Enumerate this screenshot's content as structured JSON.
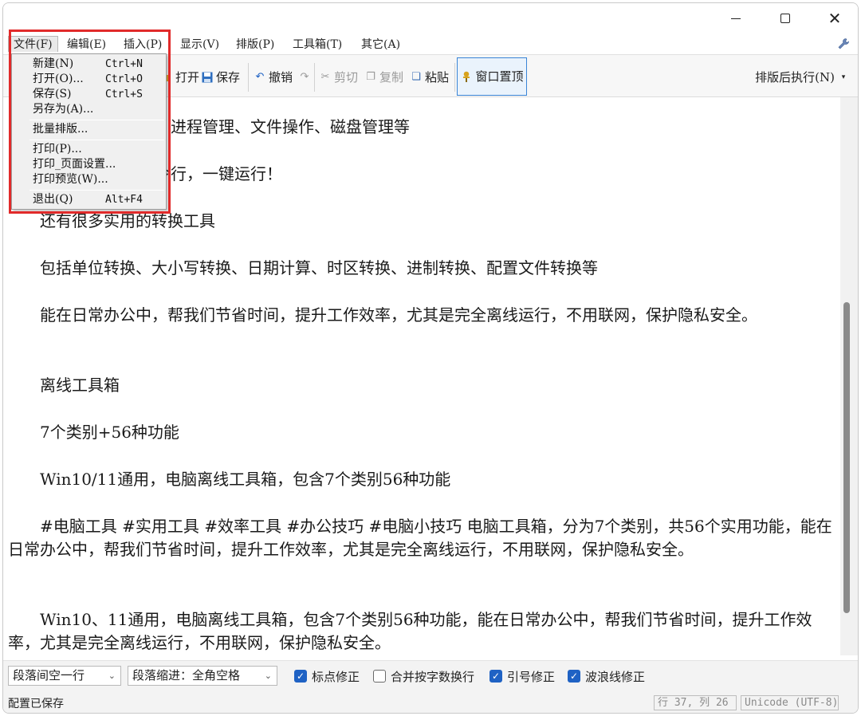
{
  "window_controls": {
    "minimize": "minimize",
    "maximize": "maximize",
    "close": "close"
  },
  "menu": [
    {
      "label": "文件(F)"
    },
    {
      "label": "编辑(E)"
    },
    {
      "label": "插入(P)"
    },
    {
      "label": "显示(V)"
    },
    {
      "label": "排版(P)"
    },
    {
      "label": "工具箱(T)"
    },
    {
      "label": "其它(A)"
    }
  ],
  "toolbar": {
    "open": "打开",
    "save": "保存",
    "undo": "撤销",
    "cut": "剪切",
    "copy": "复制",
    "paste": "粘贴",
    "pin_window": "窗口置顶",
    "exec_after_format": "排版后执行(N)"
  },
  "file_menu": {
    "items": [
      {
        "label": "新建(N)",
        "shortcut": "Ctrl+N"
      },
      {
        "label": "打开(O)...",
        "shortcut": "Ctrl+O"
      },
      {
        "label": "保存(S)",
        "shortcut": "Ctrl+S"
      },
      {
        "label": "另存为(A)...",
        "shortcut": ""
      },
      {
        "label": "批量排版...",
        "shortcut": ""
      },
      {
        "label": "打印(P)...",
        "shortcut": ""
      },
      {
        "label": "打印_页面设置...",
        "shortcut": ""
      },
      {
        "label": "打印预览(W)...",
        "shortcut": ""
      },
      {
        "label": "退出(Q)",
        "shortcut": "Alt+F4"
      }
    ]
  },
  "editor": {
    "lines": [
      "询、进程管理、文件操作、磁盘管理等",
      "命令行，一键运行！",
      "　　还有很多实用的转换工具",
      "　　包括单位转换、大小写转换、日期计算、时区转换、进制转换、配置文件转换等",
      "　　能在日常办公中，帮我们节省时间，提升工作效率，尤其是完全离线运行，不用联网，保护隐私安全。",
      "　　离线工具箱",
      "　　7个类别+56种功能",
      "　　Win10/11通用，电脑离线工具箱，包含7个类别56种功能",
      "　　#电脑工具 #实用工具 #效率工具 #办公技巧 #电脑小技巧 电脑工具箱，分为7个类别，共56个实用功能，能在日常办公中，帮我们节省时间，提升工作效率，尤其是完全离线运行，不用联网，保护隐私安全。",
      "　　Win10、11通用，电脑离线工具箱，包含7个类别56种功能，能在日常办公中，帮我们节省时间，提升工作效率，尤其是完全离线运行，不用联网，保护隐私安全。"
    ]
  },
  "options": {
    "paragraph_spacing": "段落间空一行",
    "paragraph_indent": "段落缩进：全角空格",
    "punct_fix": {
      "label": "标点修正",
      "checked": true
    },
    "merge_by_wordcount": {
      "label": "合并按字数换行",
      "checked": false
    },
    "quote_fix": {
      "label": "引号修正",
      "checked": true
    },
    "tilde_fix": {
      "label": "波浪线修正",
      "checked": true
    }
  },
  "status": {
    "message": "配置已保存",
    "position": "行 37, 列 26",
    "encoding": "Unicode (UTF-8)"
  },
  "colors": {
    "accent": "#1f62c4",
    "highlight": "#e12a2a"
  }
}
